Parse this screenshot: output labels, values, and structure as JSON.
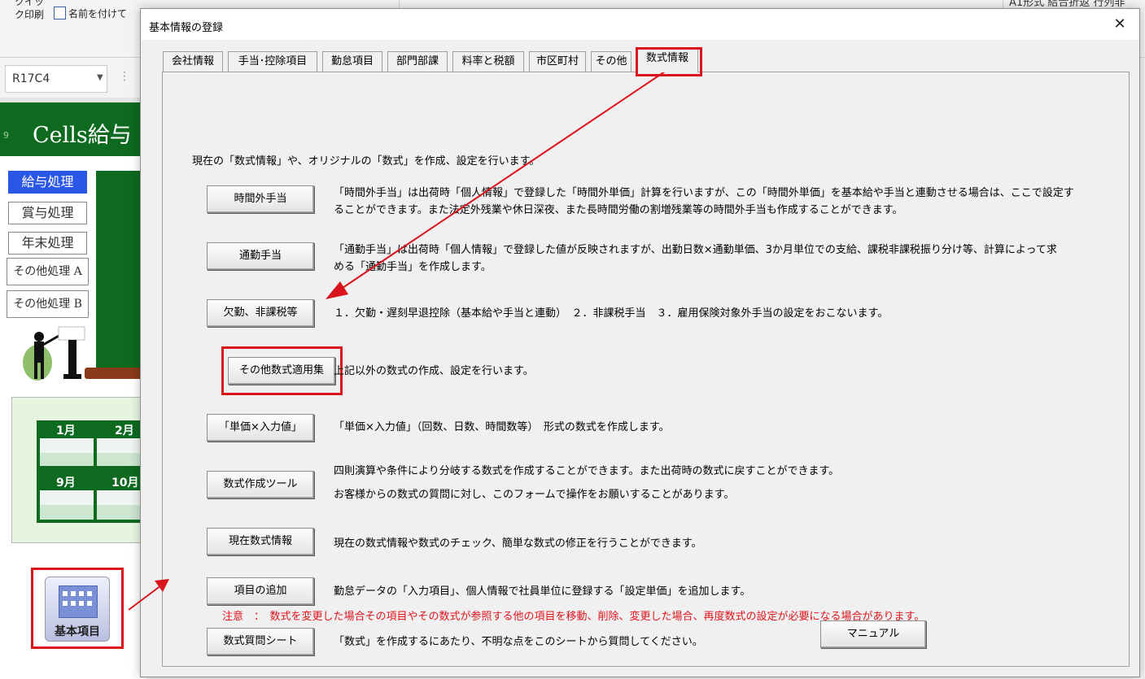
{
  "background": {
    "ribbon": {
      "quick_print": "クイック印刷",
      "save_as": "名前を付けて",
      "right_text": "A1形式 結合折返 行列非"
    },
    "name_box": "R17C4",
    "sheet_title": "Cells給与",
    "row_number": "9",
    "side_menu": [
      "給与処理",
      "賞与処理",
      "年末処理",
      "その他処理 A",
      "その他処理 B"
    ],
    "months": [
      "1月",
      "2月",
      "9月",
      "10月"
    ],
    "kihon_button": "基本項目",
    "colors": {
      "accent_red": "#d9141c",
      "sheet_green": "#0d6a1f",
      "active_menu": "#2a57e8"
    }
  },
  "dialog": {
    "title": "基本情報の登録",
    "close_icon": "close-icon",
    "tabs": [
      {
        "label": "会社情報"
      },
      {
        "label": "手当･控除項目"
      },
      {
        "label": "勤怠項目"
      },
      {
        "label": "部門部課"
      },
      {
        "label": "料率と税額"
      },
      {
        "label": "市区町村"
      },
      {
        "label": "その他"
      },
      {
        "label": "数式情報",
        "active": true
      }
    ],
    "intro": "現在の「数式情報」や、オリジナルの「数式」を作成、設定を行います。",
    "rows": [
      {
        "button": "時間外手当",
        "desc": [
          "「時間外手当」は出荷時「個人情報」で登録した「時間外単価」計算を行いますが、この「時間外単価」を基本給や手当と連動させる場合は、ここで設定す",
          "ることができます。また法定外残業や休日深夜、また長時間労働の割増残業等の時間外手当も作成することができます。"
        ]
      },
      {
        "button": "通勤手当",
        "desc": [
          "「通勤手当」は出荷時「個人情報」で登録した値が反映されますが、出勤日数×通勤単価、3か月単位での支給、課税非課税振り分け等、計算によって求",
          "める「通勤手当」を作成します。"
        ]
      },
      {
        "button": "欠勤、非課税等",
        "desc": [
          "１．欠勤・遅刻早退控除（基本給や手当と連動）　２．非課税手当　３．雇用保険対象外手当の設定をおこないます。"
        ]
      },
      {
        "button": "その他数式適用集",
        "desc": [
          "上記以外の数式の作成、設定を行います。"
        ]
      },
      {
        "button": "「単価×入力値」",
        "desc": [
          "「単価×入力値」（回数、日数、時間数等）　形式の数式を作成します。"
        ]
      },
      {
        "button": "数式作成ツール",
        "desc": [
          "四則演算や条件により分岐する数式を作成することができます。また出荷時の数式に戻すことができます。",
          "お客様からの数式の質問に対し、このフォームで操作をお願いすることがあります。"
        ]
      },
      {
        "button": "現在数式情報",
        "desc": [
          "現在の数式情報や数式のチェック、簡単な数式の修正を行うことができます。"
        ]
      },
      {
        "button": "項目の追加",
        "desc": [
          "勤怠データの「入力項目」、個人情報で社員単位に登録する「設定単価」を追加します。"
        ]
      },
      {
        "button": "数式質問シート",
        "desc": [
          "「数式」を作成するにあたり、不明な点をこのシートから質問してください。"
        ]
      }
    ],
    "manual_button": "マニュアル",
    "caution": "注意　：　数式を変更した場合その項目やその数式が参照する他の項目を移動、削除、変更した場合、再度数式の設定が必要になる場合があります。",
    "caution_color": "#e0141c"
  }
}
